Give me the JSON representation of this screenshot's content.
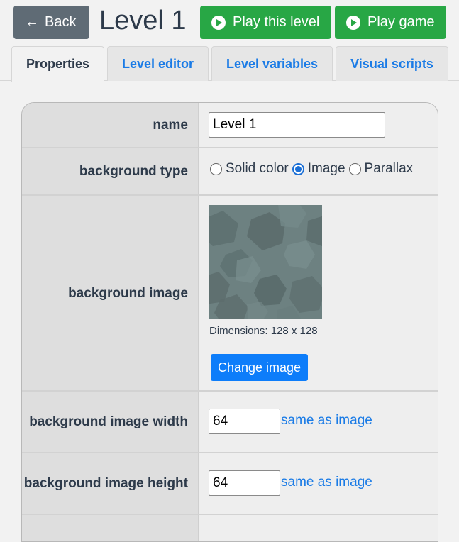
{
  "header": {
    "back_label": "Back",
    "title": "Level 1",
    "play_level_label": "Play this level",
    "play_game_label": "Play game"
  },
  "tabs": [
    {
      "label": "Properties",
      "active": true
    },
    {
      "label": "Level editor",
      "active": false
    },
    {
      "label": "Level variables",
      "active": false
    },
    {
      "label": "Visual scripts",
      "active": false
    }
  ],
  "properties": {
    "name": {
      "label": "name",
      "value": "Level 1"
    },
    "background_type": {
      "label": "background type",
      "options": [
        "Solid color",
        "Image",
        "Parallax"
      ],
      "selected": "Image"
    },
    "background_image": {
      "label": "background image",
      "dimensions_text": "Dimensions: 128 x 128",
      "change_button_label": "Change image"
    },
    "background_image_width": {
      "label": "background image width",
      "value": "64",
      "link_label": "same as image"
    },
    "background_image_height": {
      "label": "background image height",
      "value": "64",
      "link_label": "same as image"
    }
  },
  "colors": {
    "accent": "#0d7dfa",
    "play_green": "#28a745",
    "back_gray": "#5f6b75",
    "link_blue": "#1a7be6",
    "text_dark": "#2d3a4a"
  },
  "icons": {
    "back": "arrow-left-icon",
    "play": "play-circle-icon"
  }
}
